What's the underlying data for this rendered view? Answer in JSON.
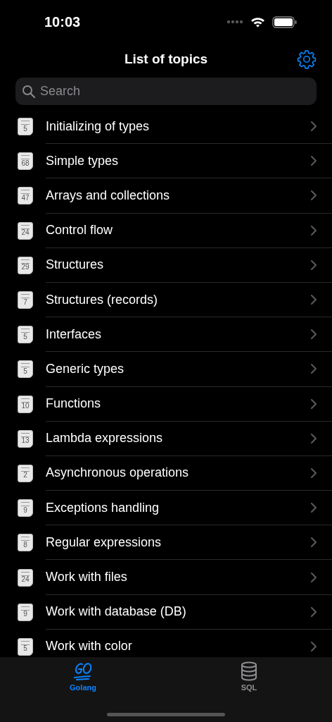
{
  "status_bar": {
    "time": "10:03"
  },
  "nav": {
    "title": "List of topics"
  },
  "search": {
    "placeholder": "Search"
  },
  "topics": [
    {
      "count": "5",
      "title": "Initializing of types"
    },
    {
      "count": "68",
      "title": "Simple types"
    },
    {
      "count": "47",
      "title": "Arrays and collections"
    },
    {
      "count": "24",
      "title": "Control flow"
    },
    {
      "count": "29",
      "title": "Structures"
    },
    {
      "count": "7",
      "title": "Structures (records)"
    },
    {
      "count": "5",
      "title": "Interfaces"
    },
    {
      "count": "5",
      "title": "Generic types"
    },
    {
      "count": "10",
      "title": "Functions"
    },
    {
      "count": "13",
      "title": "Lambda expressions"
    },
    {
      "count": "2",
      "title": "Asynchronous operations"
    },
    {
      "count": "9",
      "title": "Exceptions handling"
    },
    {
      "count": "8",
      "title": "Regular expressions"
    },
    {
      "count": "24",
      "title": "Work with files"
    },
    {
      "count": "9",
      "title": "Work with database (DB)"
    },
    {
      "count": "5",
      "title": "Work with color"
    }
  ],
  "tab_bar": [
    {
      "kind": "go",
      "label": "Golang",
      "selected": true
    },
    {
      "kind": "database",
      "label": "SQL",
      "selected": false
    }
  ]
}
